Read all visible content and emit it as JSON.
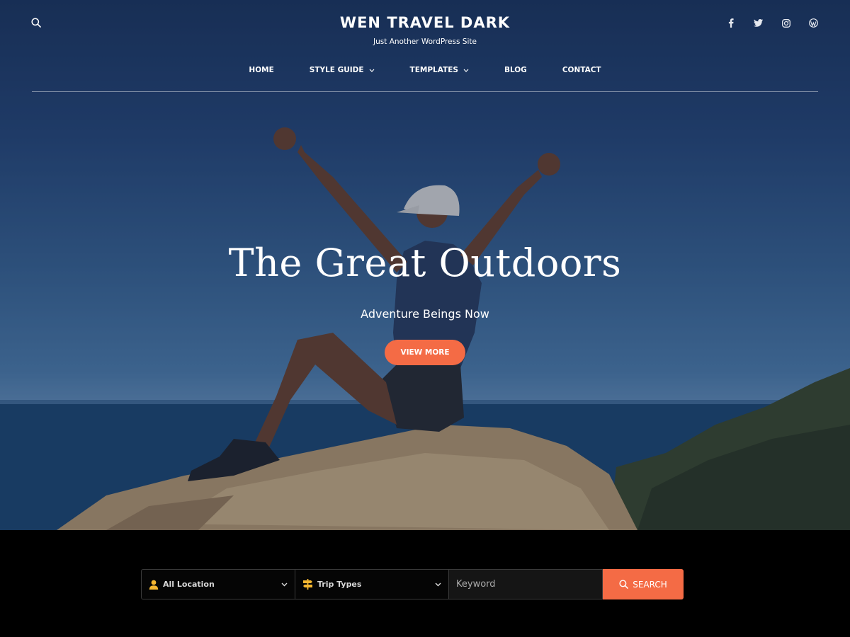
{
  "header": {
    "site_title": "WEN TRAVEL DARK",
    "site_description": "Just Another WordPress Site",
    "search_icon": "search-icon",
    "socials": [
      {
        "name": "facebook-icon"
      },
      {
        "name": "twitter-icon"
      },
      {
        "name": "instagram-icon"
      },
      {
        "name": "wordpress-icon"
      }
    ]
  },
  "nav": {
    "items": [
      {
        "label": "HOME",
        "has_dropdown": false
      },
      {
        "label": "STYLE GUIDE",
        "has_dropdown": true
      },
      {
        "label": "TEMPLATES",
        "has_dropdown": true
      },
      {
        "label": "BLOG",
        "has_dropdown": false
      },
      {
        "label": "CONTACT",
        "has_dropdown": false
      }
    ]
  },
  "hero": {
    "title": "The Great Outdoors",
    "subtitle": "Adventure Beings Now",
    "button_label": "VIEW MORE"
  },
  "trip_search": {
    "location_label": "All Location",
    "trip_types_label": "Trip Types",
    "keyword_placeholder": "Keyword",
    "button_label": "SEARCH"
  },
  "colors": {
    "accent": "#f46b45",
    "icon_yellow": "#f5b731",
    "background": "#000000"
  }
}
